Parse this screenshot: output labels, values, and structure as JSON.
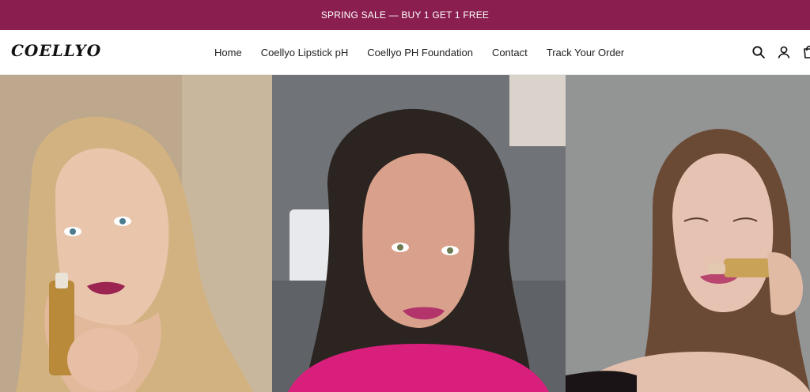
{
  "announcement": {
    "text": "SPRING SALE — BUY 1 GET 1 FREE"
  },
  "brand": {
    "logo_text": "COELLYO"
  },
  "nav": {
    "items": [
      {
        "label": "Home"
      },
      {
        "label": "Coellyo Lipstick pH"
      },
      {
        "label": "Coellyo PH Foundation"
      },
      {
        "label": "Contact"
      },
      {
        "label": "Track Your Order"
      }
    ]
  },
  "header_icons": [
    "search-icon",
    "account-icon",
    "cart-icon"
  ],
  "colors": {
    "announcement_bg": "#8a1f4f",
    "text": "#222222"
  },
  "gallery": {
    "panels": [
      {
        "name": "testimonial-video-1"
      },
      {
        "name": "testimonial-video-2"
      },
      {
        "name": "testimonial-video-3"
      }
    ]
  }
}
